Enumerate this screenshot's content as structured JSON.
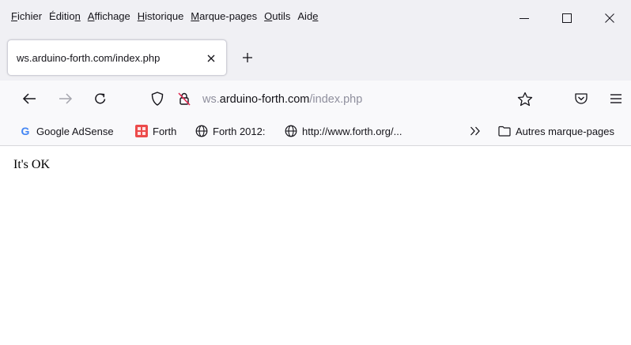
{
  "menu": {
    "items": [
      {
        "pre": "",
        "key": "F",
        "post": "ichier"
      },
      {
        "pre": "Éditio",
        "key": "n",
        "post": ""
      },
      {
        "pre": "",
        "key": "A",
        "post": "ffichage"
      },
      {
        "pre": "",
        "key": "H",
        "post": "istorique"
      },
      {
        "pre": "",
        "key": "M",
        "post": "arque-pages"
      },
      {
        "pre": "",
        "key": "O",
        "post": "utils"
      },
      {
        "pre": "Aid",
        "key": "e",
        "post": ""
      }
    ]
  },
  "window_controls": {
    "minimize": "minimize-icon",
    "maximize": "maximize-icon",
    "close": "close-icon"
  },
  "tab": {
    "title": "ws.arduino-forth.com/index.php"
  },
  "address": {
    "host_prefix": "ws.",
    "host": "arduino-forth.com",
    "path": "/index.php"
  },
  "bookmarks": {
    "items": [
      {
        "label": "Google AdSense",
        "icon": "google-icon"
      },
      {
        "label": "Forth",
        "icon": "forth-icon"
      },
      {
        "label": "Forth 2012:",
        "icon": "globe-icon"
      },
      {
        "label": "http://www.forth.org/...",
        "icon": "globe-icon"
      }
    ],
    "other": "Autres marque-pages"
  },
  "page": {
    "text": "It's OK"
  },
  "colors": {
    "chrome": "#f0f0f4",
    "toolbar": "#f9f9fb",
    "text": "#15141a",
    "muted": "#8f8f9d",
    "forth_icon": "#ec4b4b",
    "google_blue": "#4285f4"
  }
}
